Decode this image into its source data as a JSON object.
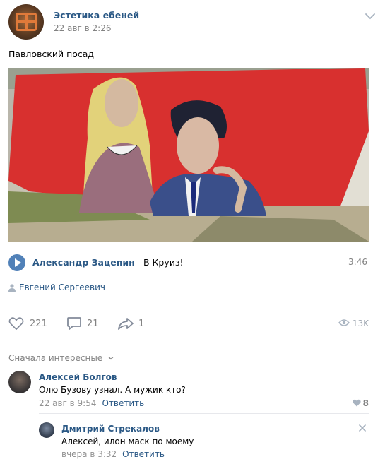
{
  "post": {
    "author": "Эстетика ебеней",
    "date": "22 авг в 2:26",
    "text": "Павловский посад",
    "photo_name": "graffiti-photo"
  },
  "audio": {
    "artist": "Александр Зацепин",
    "dash": "—",
    "title": "В Круиз!",
    "duration": "3:46"
  },
  "signer": "Евгений Сергеевич",
  "actions": {
    "likes": "221",
    "comments": "21",
    "shares": "1",
    "views": "13K"
  },
  "comments_sort": "Сначала интересные",
  "comments": [
    {
      "name": "Алексей Болгов",
      "text": "Олю Бузову узнал. А мужик кто?",
      "date": "22 авг в 9:54",
      "reply": "Ответить",
      "likes": "8"
    },
    {
      "name": "Дмитрий Стрекалов",
      "text": "Алексей, илон маск по моему",
      "date": "вчера в 3:32",
      "reply": "Ответить"
    }
  ],
  "colors": {
    "link": "#2a5885",
    "accent": "#5181b8",
    "muted": "#828282",
    "wall_red": "#d8302f"
  }
}
